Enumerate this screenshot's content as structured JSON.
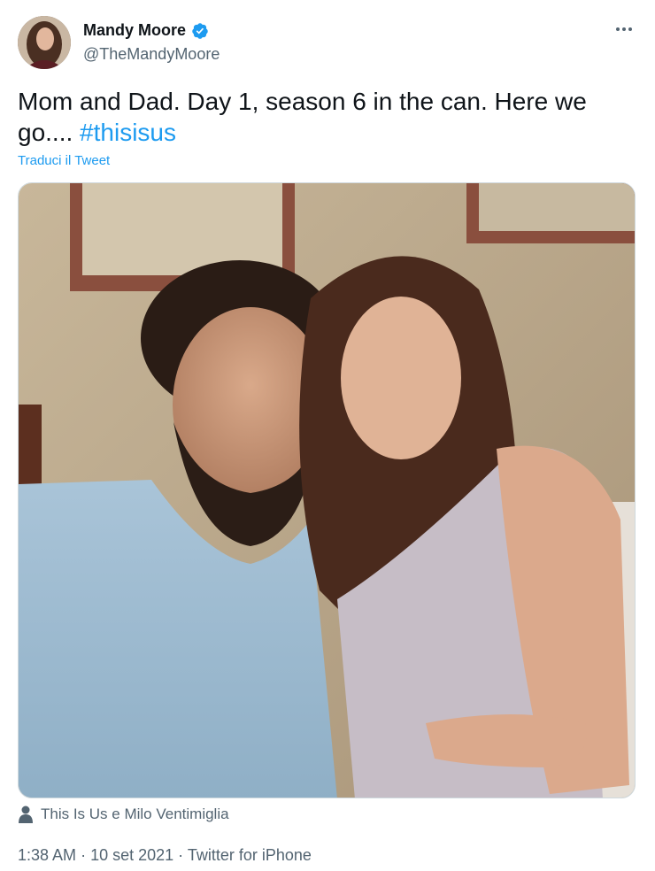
{
  "author": {
    "display_name": "Mandy Moore",
    "handle": "@TheMandyMoore",
    "verified": true
  },
  "tweet": {
    "text": "Mom and Dad. Day 1, season 6 in the can. Here we go....",
    "hashtag": "#thisisus",
    "translate_label": "Traduci il Tweet"
  },
  "tagged": {
    "label": "This Is Us e Milo Ventimiglia"
  },
  "meta": {
    "time": "1:38 AM",
    "separator": "·",
    "date": "10 set 2021",
    "source": "Twitter for iPhone"
  },
  "colors": {
    "link": "#1d9bf0",
    "secondary_text": "#536471",
    "primary_text": "#0f1419"
  },
  "icons": {
    "verified": "verified-badge-icon",
    "more": "more-options-icon",
    "tagged": "person-icon"
  }
}
